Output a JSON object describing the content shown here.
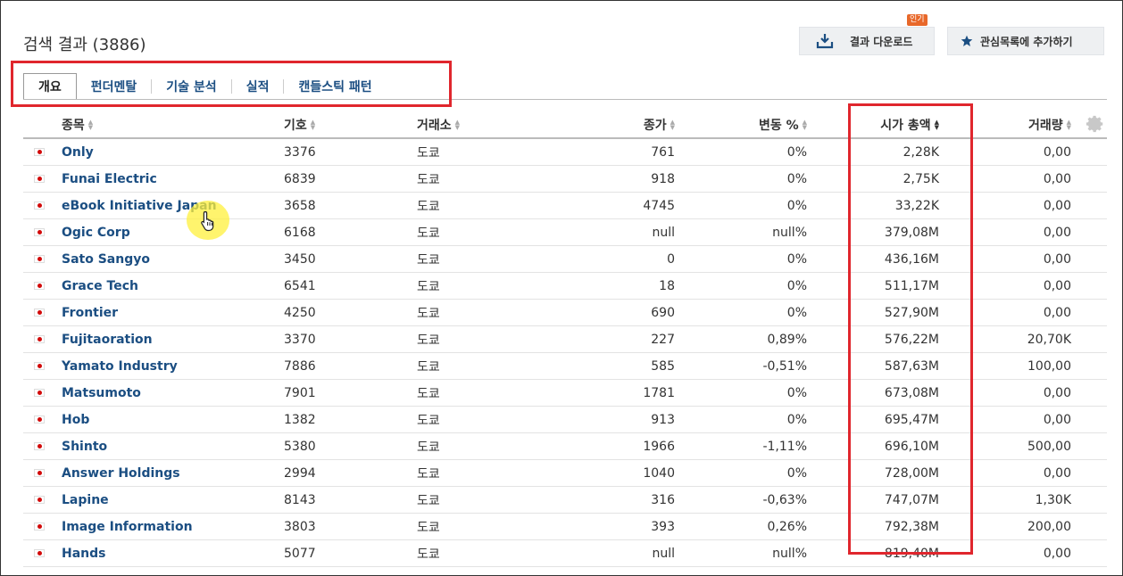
{
  "page": {
    "title": "검색 결과 (3886)"
  },
  "actions": {
    "download_label": "결과 다운로드",
    "download_badge": "인기",
    "watchlist_label": "관심목록에 추가하기"
  },
  "tabs": [
    {
      "label": "개요",
      "active": true
    },
    {
      "label": "펀더멘탈",
      "active": false
    },
    {
      "label": "기술 분석",
      "active": false
    },
    {
      "label": "실적",
      "active": false
    },
    {
      "label": "캔들스틱 패턴",
      "active": false
    }
  ],
  "table": {
    "headers": {
      "name": "종목",
      "symbol": "기호",
      "exchange": "거래소",
      "price": "종가",
      "change": "변동 %",
      "market_cap": "시가 총액",
      "volume": "거래량"
    },
    "rows": [
      {
        "name": "Only",
        "symbol": "3376",
        "exchange": "도쿄",
        "price": "761",
        "change": "0%",
        "market_cap": "2,28K",
        "volume": "0,00"
      },
      {
        "name": "Funai Electric",
        "symbol": "6839",
        "exchange": "도쿄",
        "price": "918",
        "change": "0%",
        "market_cap": "2,75K",
        "volume": "0,00"
      },
      {
        "name": "eBook Initiative Japan",
        "symbol": "3658",
        "exchange": "도쿄",
        "price": "4745",
        "change": "0%",
        "market_cap": "33,22K",
        "volume": "0,00"
      },
      {
        "name": "Ogic Corp",
        "symbol": "6168",
        "exchange": "도쿄",
        "price": "null",
        "change": "null%",
        "market_cap": "379,08M",
        "volume": "0,00"
      },
      {
        "name": "Sato Sangyo",
        "symbol": "3450",
        "exchange": "도쿄",
        "price": "0",
        "change": "0%",
        "market_cap": "436,16M",
        "volume": "0,00"
      },
      {
        "name": "Grace Tech",
        "symbol": "6541",
        "exchange": "도쿄",
        "price": "18",
        "change": "0%",
        "market_cap": "511,17M",
        "volume": "0,00"
      },
      {
        "name": "Frontier",
        "symbol": "4250",
        "exchange": "도쿄",
        "price": "690",
        "change": "0%",
        "market_cap": "527,90M",
        "volume": "0,00"
      },
      {
        "name": "Fujitaoration",
        "symbol": "3370",
        "exchange": "도쿄",
        "price": "227",
        "change": "0,89%",
        "market_cap": "576,22M",
        "volume": "20,70K"
      },
      {
        "name": "Yamato Industry",
        "symbol": "7886",
        "exchange": "도쿄",
        "price": "585",
        "change": "-0,51%",
        "market_cap": "587,63M",
        "volume": "100,00"
      },
      {
        "name": "Matsumoto",
        "symbol": "7901",
        "exchange": "도쿄",
        "price": "1781",
        "change": "0%",
        "market_cap": "673,08M",
        "volume": "0,00"
      },
      {
        "name": "Hob",
        "symbol": "1382",
        "exchange": "도쿄",
        "price": "913",
        "change": "0%",
        "market_cap": "695,47M",
        "volume": "0,00"
      },
      {
        "name": "Shinto",
        "symbol": "5380",
        "exchange": "도쿄",
        "price": "1966",
        "change": "-1,11%",
        "market_cap": "696,10M",
        "volume": "500,00"
      },
      {
        "name": "Answer Holdings",
        "symbol": "2994",
        "exchange": "도쿄",
        "price": "1040",
        "change": "0%",
        "market_cap": "728,00M",
        "volume": "0,00"
      },
      {
        "name": "Lapine",
        "symbol": "8143",
        "exchange": "도쿄",
        "price": "316",
        "change": "-0,63%",
        "market_cap": "747,07M",
        "volume": "1,30K"
      },
      {
        "name": "Image Information",
        "symbol": "3803",
        "exchange": "도쿄",
        "price": "393",
        "change": "0,26%",
        "market_cap": "792,38M",
        "volume": "200,00"
      },
      {
        "name": "Hands",
        "symbol": "5077",
        "exchange": "도쿄",
        "price": "null",
        "change": "null%",
        "market_cap": "819,40M",
        "volume": "0,00"
      }
    ]
  },
  "icons": {
    "download": "download-icon",
    "star": "star-icon",
    "flag": "japan-flag-icon",
    "settings": "gear-icon",
    "cursor": "hand-cursor-icon"
  },
  "colors": {
    "link": "#1b4e82",
    "highlight_border": "#e0262d",
    "button_bg": "#eef0f2",
    "badge": "#e8682a"
  }
}
